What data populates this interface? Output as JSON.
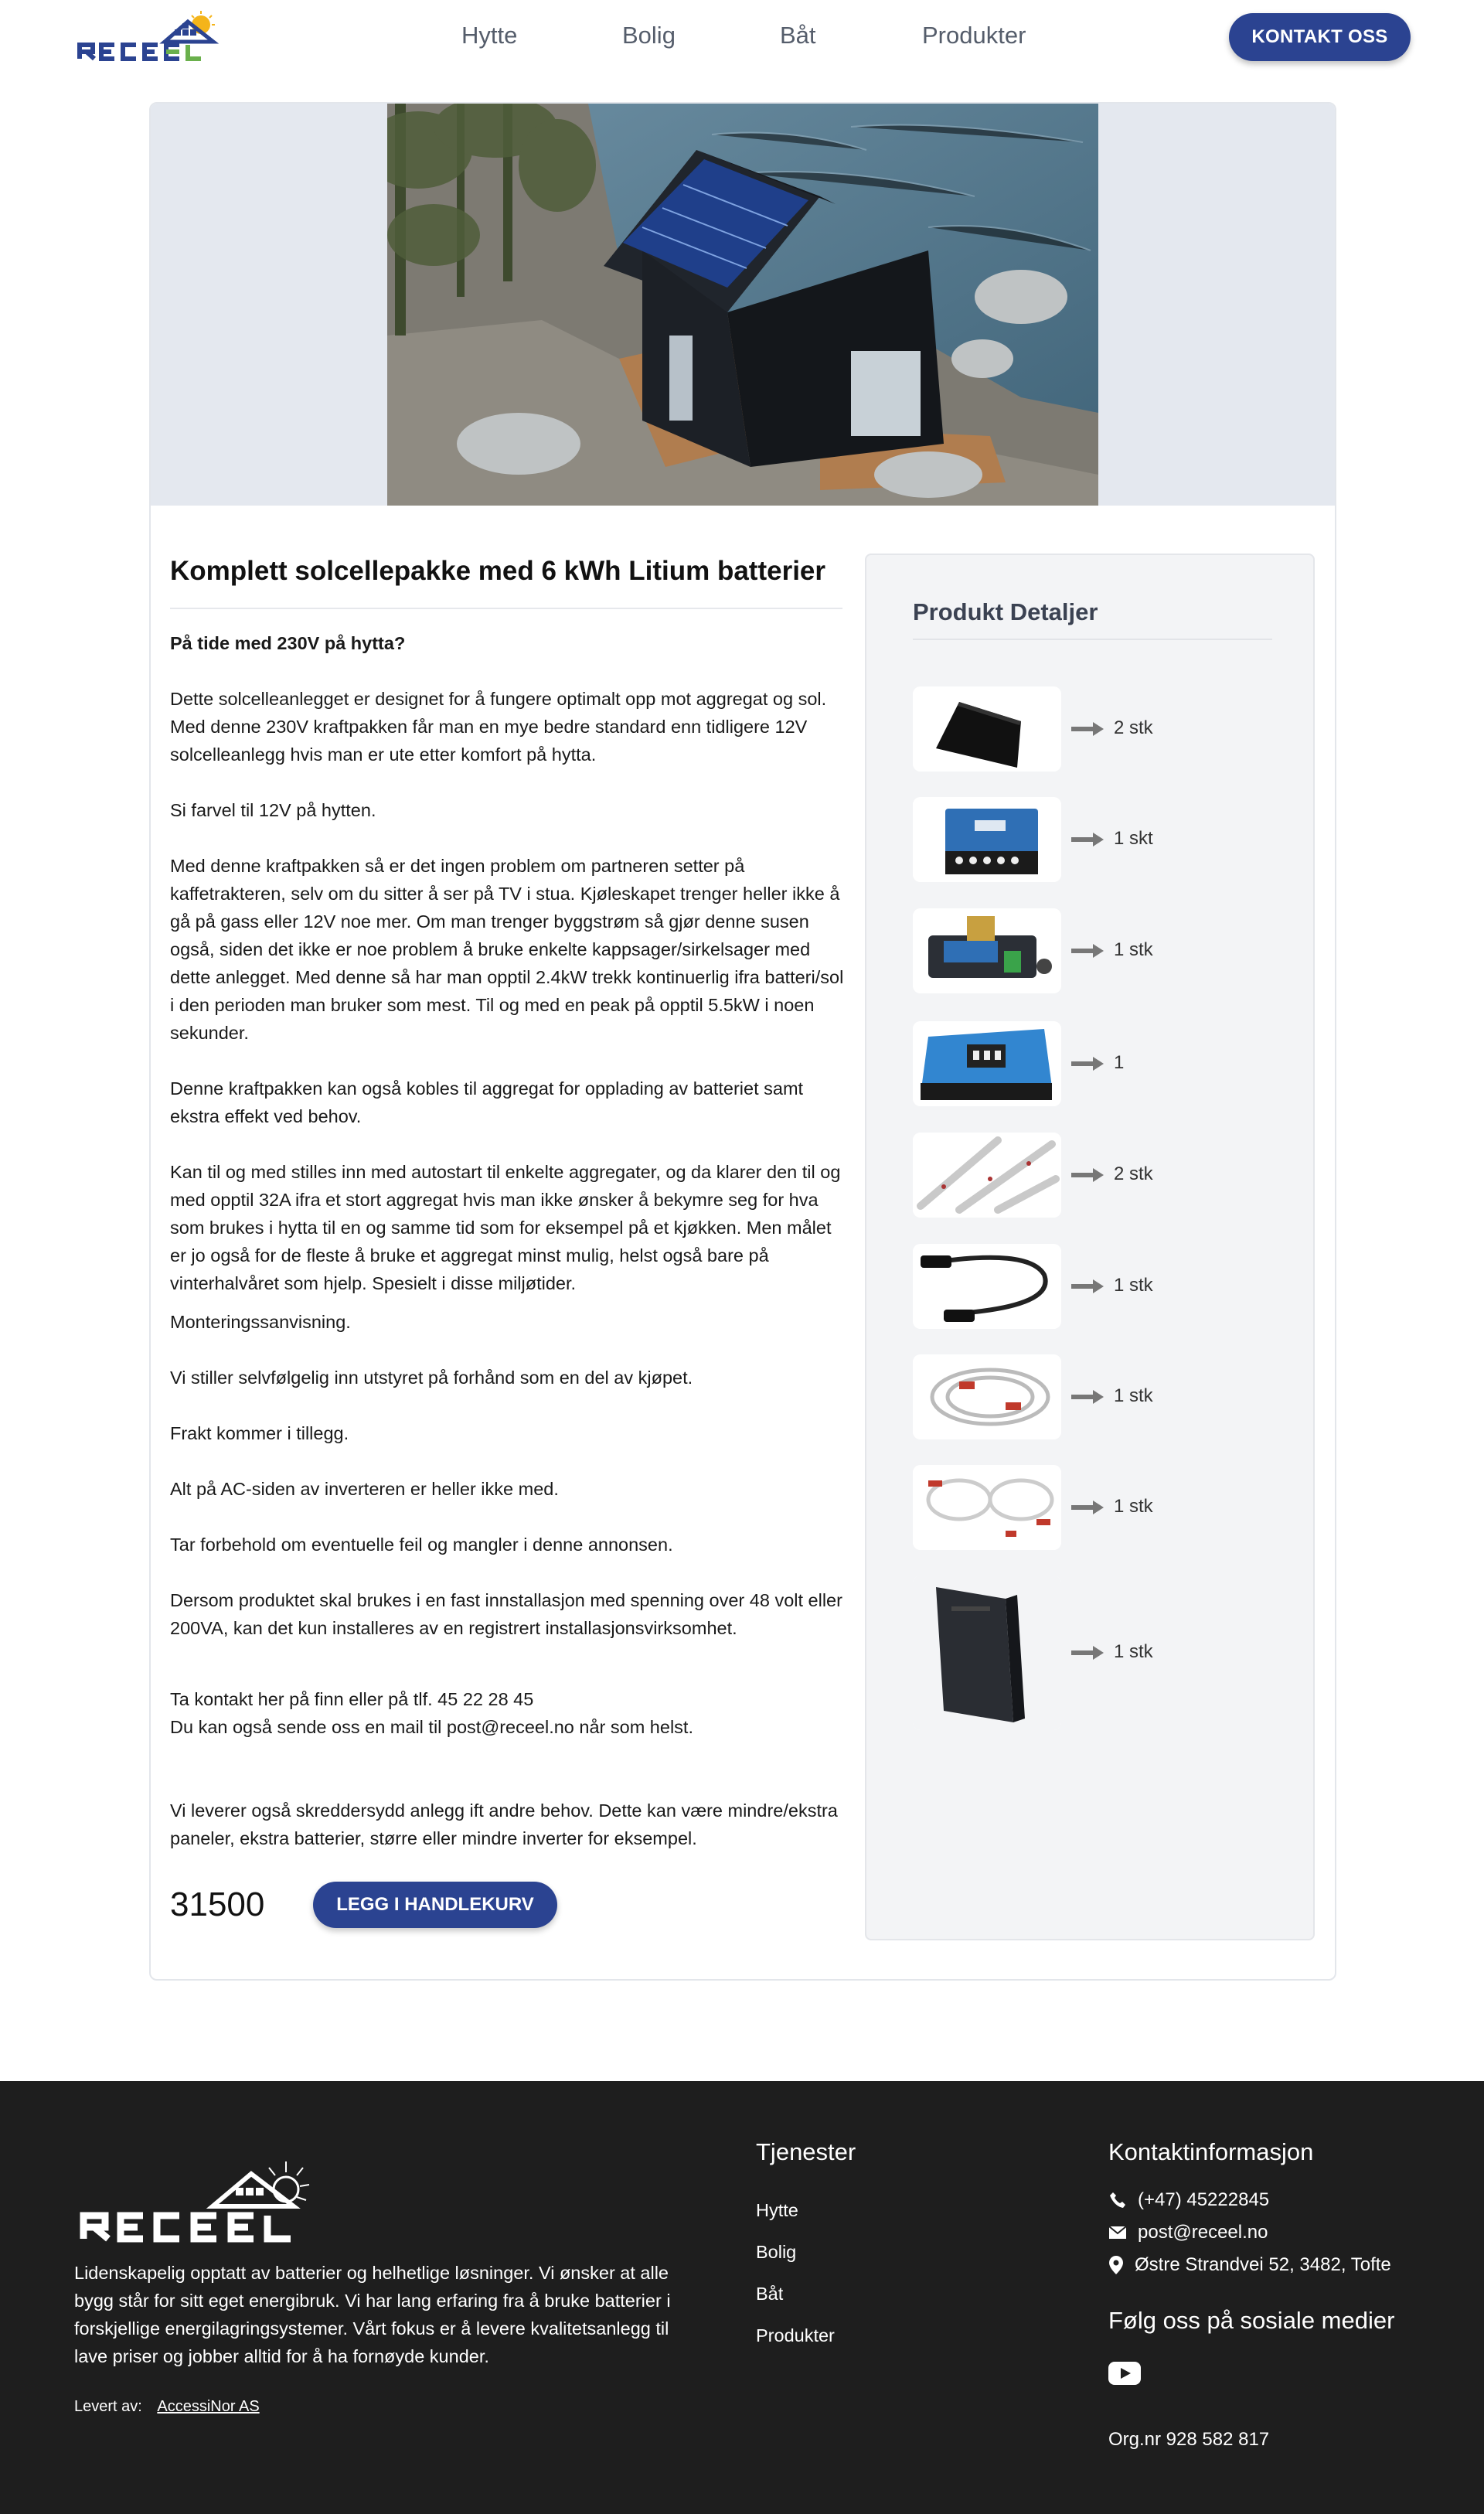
{
  "header": {
    "nav": [
      "Hytte",
      "Bolig",
      "Båt",
      "Produkter"
    ],
    "cta": "KONTAKT OSS"
  },
  "product": {
    "title": "Komplett solcellepakke med 6 kWh Litium batterier",
    "paragraphs": [
      "På tide med 230V på hytta?",
      "Dette solcelleanlegget er designet for å fungere optimalt opp mot aggregat og sol. Med denne 230V kraftpakken får man en mye bedre standard enn tidligere 12V solcelleanlegg hvis man er ute etter komfort på hytta.",
      "Si farvel til 12V på hytten.",
      "Med denne kraftpakken så er det ingen problem om partneren setter på kaffetrakteren, selv om du sitter å ser på TV i stua. Kjøleskapet trenger heller ikke å gå på gass eller 12V noe mer. Om man trenger byggstrøm så gjør denne susen også, siden det ikke er noe problem å bruke enkelte kappsager/sirkelsager med dette anlegget. Med denne så har man opptil 2.4kW trekk kontinuerlig ifra batteri/sol i den perioden man bruker som mest. Til og med en peak på opptil 5.5kW i noen sekunder.",
      "Denne kraftpakken kan også kobles til aggregat for opplading av batteriet samt ekstra effekt ved behov.",
      "Kan til og med stilles inn med autostart til enkelte aggregater, og da klarer den til og med opptil 32A ifra et stort aggregat hvis man ikke ønsker å bekymre seg for hva som brukes i hytta til en og samme tid som for eksempel på et kjøkken. Men målet er jo også for de fleste å bruke et aggregat minst mulig, helst også bare på vinterhalvåret som hjelp. Spesielt i disse miljøtider.",
      "Monteringssanvisning.",
      "Vi stiller selvfølgelig inn utstyret på forhånd som en del av kjøpet.",
      "Frakt kommer i tillegg.",
      "Alt på AC-siden av inverteren er heller ikke med.",
      "Tar forbehold om eventuelle feil og mangler i denne annonsen.",
      "Dersom produktet skal brukes i en fast innstallasjon med spenning over 48 volt eller 200VA, kan det kun installeres av en registrert installasjonsvirksomhet.",
      "Ta kontakt her på finn eller på tlf. 45 22 28 45\nDu kan også sende oss en mail til post@receel.no når som helst.",
      "Vi leverer også skreddersydd anlegg ift andre behov. Dette kan være mindre/ekstra paneler, ekstra batterier, større eller mindre inverter for eksempel."
    ],
    "price": "31500",
    "cart_button": "LEGG I HANDLEKURV"
  },
  "details": {
    "title": "Produkt Detaljer",
    "items": [
      {
        "icon": "solar-panel-icon",
        "qty": "2 stk"
      },
      {
        "icon": "inverter-icon",
        "qty": "1 skt"
      },
      {
        "icon": "battery-monitor-icon",
        "qty": "1 stk"
      },
      {
        "icon": "charge-controller-icon",
        "qty": "1"
      },
      {
        "icon": "mounting-rail-icon",
        "qty": "2 stk"
      },
      {
        "icon": "mc4-cable-icon",
        "qty": "1 stk"
      },
      {
        "icon": "battery-cable-icon",
        "qty": "1 stk"
      },
      {
        "icon": "cable-set-icon",
        "qty": "1 stk"
      },
      {
        "icon": "lithium-battery-icon",
        "qty": "1 stk"
      }
    ]
  },
  "footer": {
    "description": "Lidenskapelig opptatt av batterier og helhetlige løsninger. Vi ønsker at alle bygg står for sitt eget energibruk. Vi har lang erfaring fra å bruke batterier i forskjellige energilagringsystemer. Vårt fokus er å levere kvalitetsanlegg til lave priser og jobber alltid for å ha fornøyde kunder.",
    "credit_label": "Levert av:",
    "credit_link": "AccessiNor AS",
    "services_title": "Tjenester",
    "services": [
      "Hytte",
      "Bolig",
      "Båt",
      "Produkter"
    ],
    "contact_title": "Kontaktinformasjon",
    "phone": "(+47) 45222845",
    "email": "post@receel.no",
    "address": "Østre Strandvei 52, 3482, Tofte",
    "social_title": "Følg oss på sosiale medier",
    "org": "Org.nr 928 582 817"
  },
  "colors": {
    "brand": "#2b4391",
    "footer_bg": "#1e1e1e",
    "panel_bg": "#f3f4f6"
  }
}
